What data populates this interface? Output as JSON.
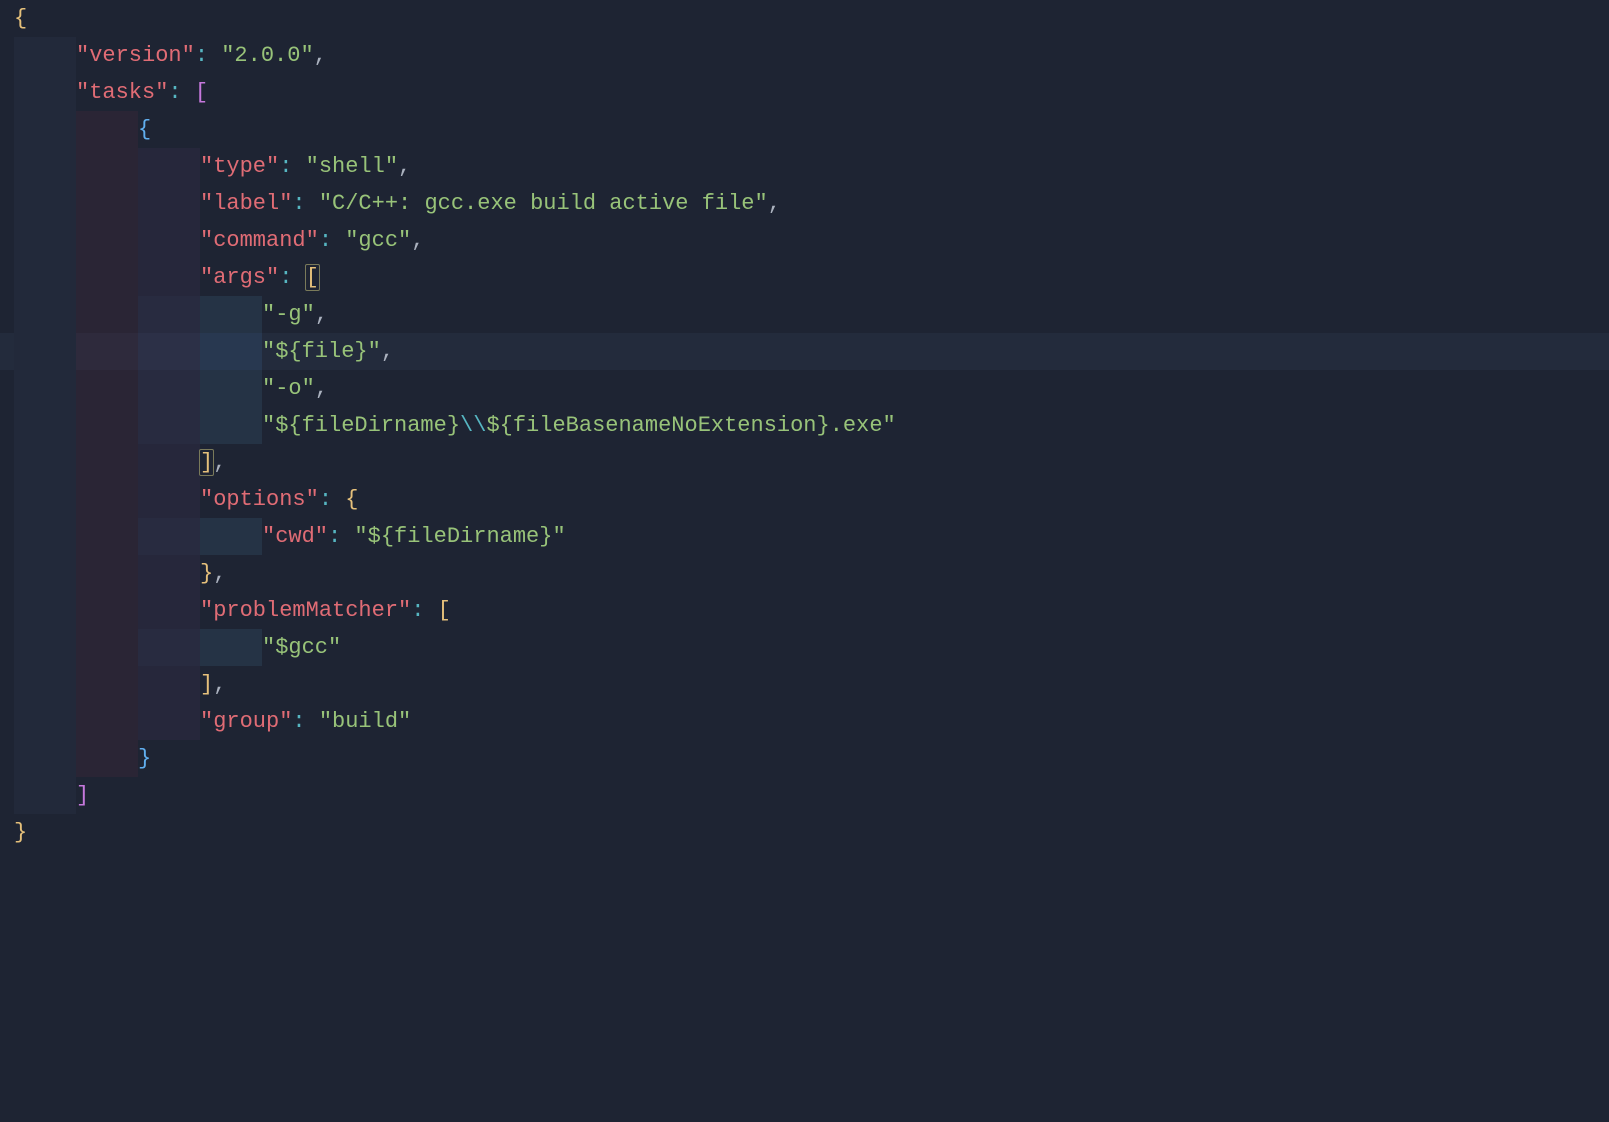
{
  "code": {
    "open_brace": "{",
    "version_key": "\"version\"",
    "version_val": "\"2.0.0\"",
    "tasks_key": "\"tasks\"",
    "tasks_open": "[",
    "task_open_brace": "{",
    "type_key": "\"type\"",
    "type_val": "\"shell\"",
    "label_key": "\"label\"",
    "label_val": "\"C/C++: gcc.exe build active file\"",
    "command_key": "\"command\"",
    "command_val": "\"gcc\"",
    "args_key": "\"args\"",
    "args_open": "[",
    "arg0": "\"-g\"",
    "arg1": "\"${file}\"",
    "arg2": "\"-o\"",
    "arg3_a": "\"${fileDirname}",
    "arg3_esc": "\\\\",
    "arg3_b": "${fileBasenameNoExtension}.exe\"",
    "args_close": "]",
    "options_key": "\"options\"",
    "options_open": "{",
    "cwd_key": "\"cwd\"",
    "cwd_val": "\"${fileDirname}\"",
    "options_close": "}",
    "pm_key": "\"problemMatcher\"",
    "pm_open": "[",
    "pm_val": "\"$gcc\"",
    "pm_close": "]",
    "group_key": "\"group\"",
    "group_val": "\"build\"",
    "task_close_brace": "}",
    "tasks_close": "]",
    "close_brace": "}",
    "colon": ":",
    "comma": ",",
    "space": " "
  }
}
